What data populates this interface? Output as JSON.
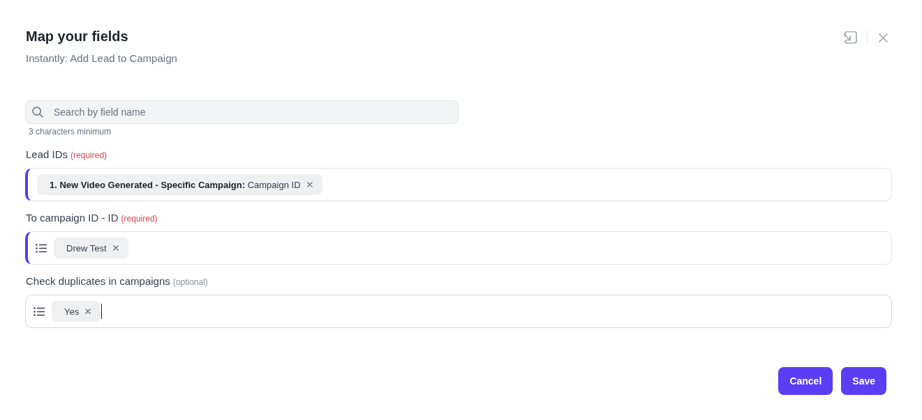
{
  "dialog": {
    "title": "Map your fields",
    "subtitle": "Instantly: Add Lead to Campaign"
  },
  "search": {
    "placeholder": "Search by field name",
    "hint": "3 characters minimum"
  },
  "fields": [
    {
      "label": "Lead IDs",
      "note": "(required)",
      "required": true,
      "kind": "text",
      "focused": false,
      "chips": [
        "**1. New Video Generated - Specific Campaign:** Campaign ID"
      ]
    },
    {
      "label": "To campaign ID - ID",
      "note": "(required)",
      "required": true,
      "kind": "select",
      "focused": false,
      "chips": [
        "Drew Test"
      ]
    },
    {
      "label": "Check duplicates in campaigns",
      "note": "(optional)",
      "required": false,
      "kind": "select",
      "focused": true,
      "chips": [
        "Yes"
      ]
    }
  ],
  "buttons": [
    {
      "label": "Cancel"
    },
    {
      "label": "Save"
    }
  ]
}
